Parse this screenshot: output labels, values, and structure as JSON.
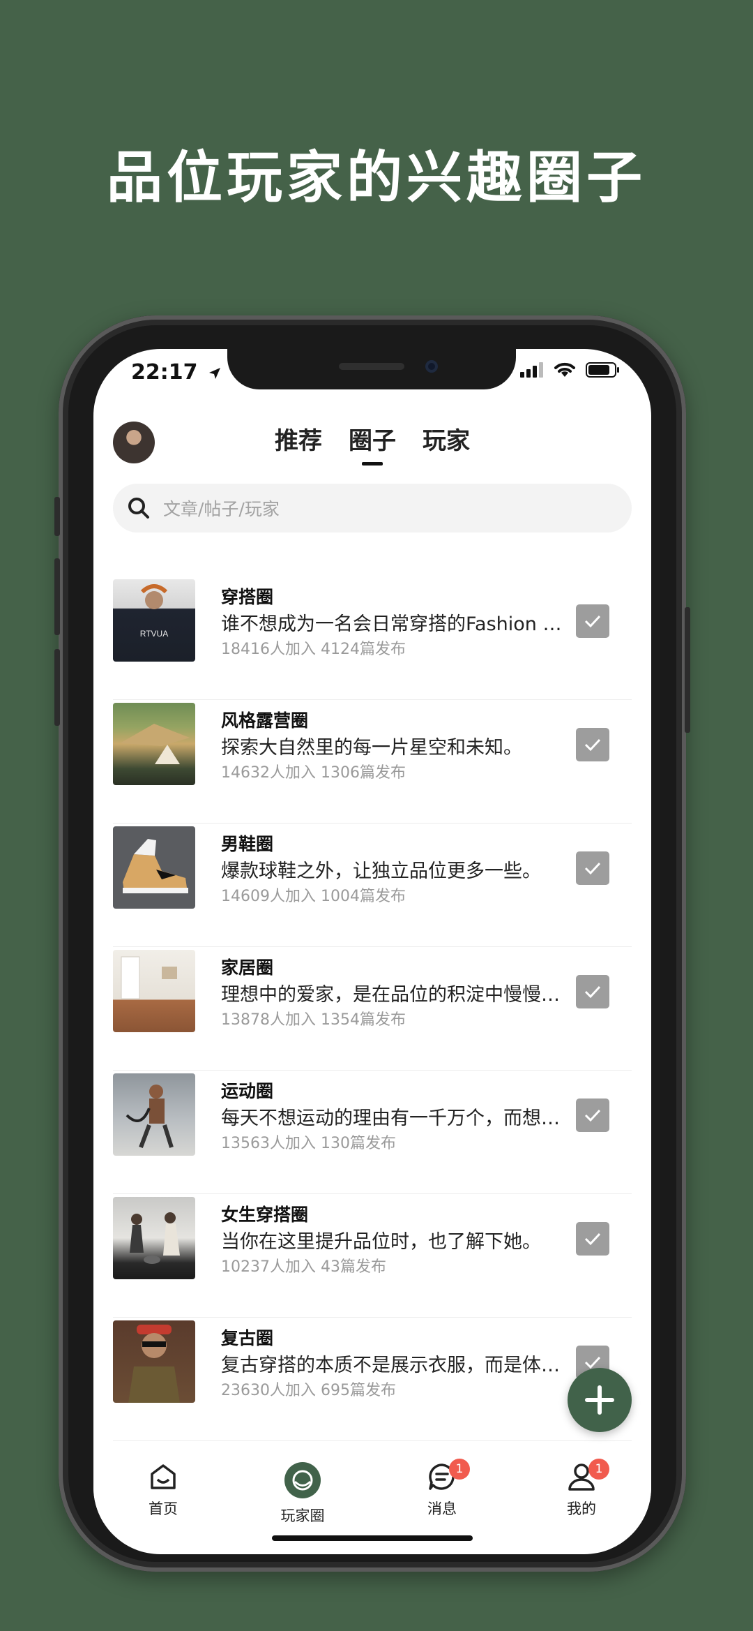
{
  "headline": "品位玩家的兴趣圈子",
  "status_bar": {
    "time": "22:17"
  },
  "header": {
    "tabs": [
      {
        "label": "推荐",
        "active": false
      },
      {
        "label": "圈子",
        "active": true
      },
      {
        "label": "玩家",
        "active": false
      }
    ]
  },
  "search": {
    "placeholder": "文章/帖子/玩家"
  },
  "circles": [
    {
      "title": "穿搭圈",
      "desc": "谁不想成为一名会日常穿搭的Fashion Guy",
      "stats": "18416人加入  4124篇发布"
    },
    {
      "title": "风格露营圈",
      "desc": "探索大自然里的每一片星空和未知。",
      "stats": "14632人加入  1306篇发布"
    },
    {
      "title": "男鞋圈",
      "desc": "爆款球鞋之外，让独立品位更多一些。",
      "stats": "14609人加入  1004篇发布"
    },
    {
      "title": "家居圈",
      "desc": "理想中的爱家，是在品位的积淀中慢慢打造",
      "stats": "13878人加入  1354篇发布"
    },
    {
      "title": "运动圈",
      "desc": "每天不想运动的理由有一千万个，而想运动的",
      "stats": "13563人加入  130篇发布"
    },
    {
      "title": "女生穿搭圈",
      "desc": "当你在这里提升品位时，也了解下她。",
      "stats": "10237人加入  43篇发布"
    },
    {
      "title": "复古圈",
      "desc": "复古穿搭的本质不是展示衣服，而是体现态度",
      "stats": "23630人加入  695篇发布"
    }
  ],
  "tabbar": {
    "items": [
      {
        "label": "首页",
        "icon": "home-icon",
        "badge": ""
      },
      {
        "label": "玩家圈",
        "icon": "circle-icon",
        "badge": ""
      },
      {
        "label": "消息",
        "icon": "message-icon",
        "badge": "1"
      },
      {
        "label": "我的",
        "icon": "profile-icon",
        "badge": "1"
      }
    ]
  },
  "colors": {
    "background": "#456249",
    "accent": "#41624a",
    "badge": "#f15b4e",
    "check": "#9d9d9d"
  }
}
